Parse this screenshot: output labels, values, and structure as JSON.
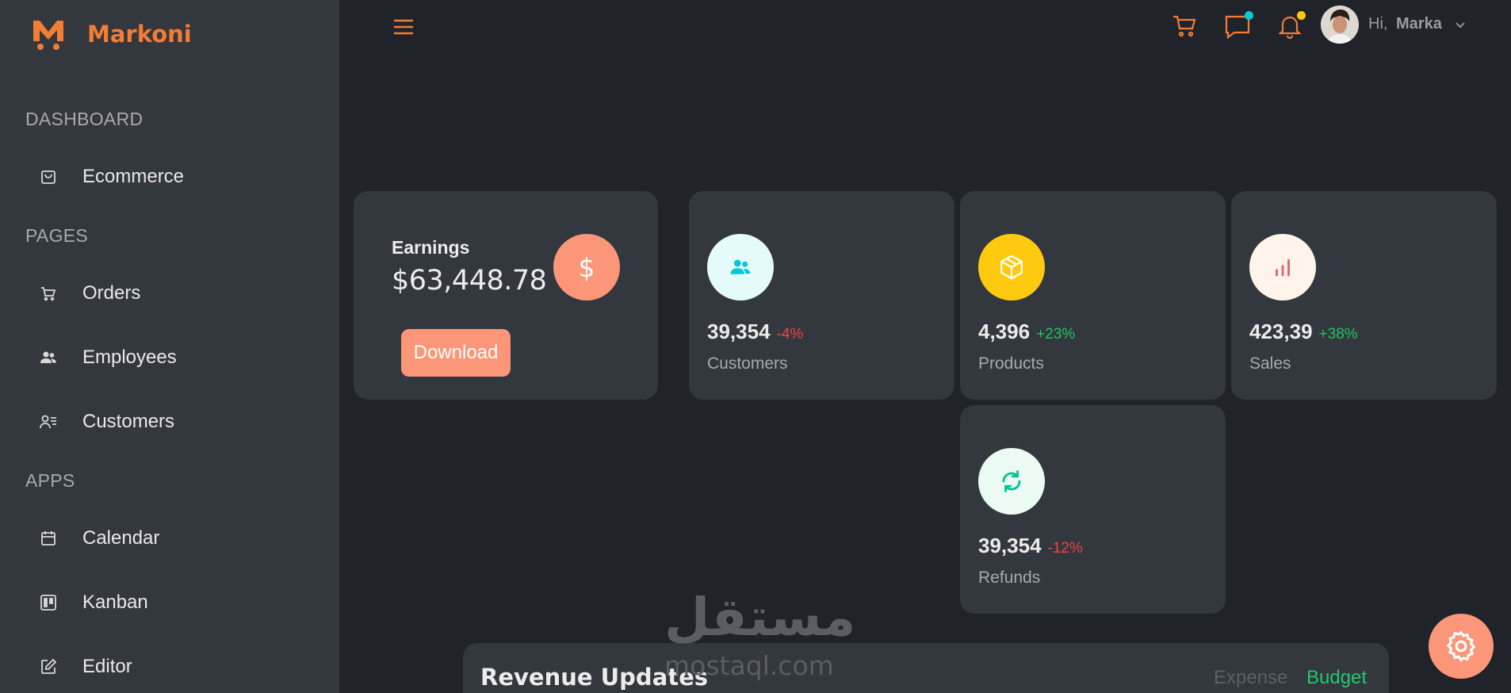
{
  "brand": {
    "name": "Markoni",
    "accent": "#f27d35"
  },
  "sidebar": {
    "sections": [
      {
        "title": "DASHBOARD",
        "items": [
          {
            "label": "Ecommerce",
            "icon": "shopping-bag-icon"
          }
        ]
      },
      {
        "title": "PAGES",
        "items": [
          {
            "label": "Orders",
            "icon": "cart-icon"
          },
          {
            "label": "Employees",
            "icon": "users-icon"
          },
          {
            "label": "Customers",
            "icon": "user-list-icon"
          }
        ]
      },
      {
        "title": "APPS",
        "items": [
          {
            "label": "Calendar",
            "icon": "calendar-icon"
          },
          {
            "label": "Kanban",
            "icon": "kanban-icon"
          },
          {
            "label": "Editor",
            "icon": "edit-icon"
          }
        ]
      }
    ]
  },
  "topbar": {
    "greeting": "Hi,",
    "user_name": "Marka",
    "icons": [
      "menu-icon",
      "cart-icon",
      "chat-icon",
      "bell-icon",
      "chevron-down-icon"
    ],
    "chat_dot_color": "#03c9d7",
    "bell_dot_color": "#fec90f"
  },
  "earnings": {
    "label": "Earnings",
    "value": "$63,448.78",
    "icon_symbol": "$",
    "download_label": "Download",
    "color": "#fb9678"
  },
  "stats": [
    {
      "value": "39,354",
      "change": "-4%",
      "label": "Customers",
      "icon": "users-icon",
      "icon_color": "#03c9d7",
      "icon_bg": "#e5fafb",
      "change_color": "#ef4444"
    },
    {
      "value": "4,396",
      "change": "+23%",
      "label": "Products",
      "icon": "box-icon",
      "icon_color": "#ffffff",
      "icon_bg": "#fec90f",
      "change_color": "#22c55e"
    },
    {
      "value": "423,39",
      "change": "+38%",
      "label": "Sales",
      "icon": "bar-chart-icon",
      "icon_color": "#e46a76",
      "icon_bg": "#fff4ea",
      "change_color": "#22c55e"
    },
    {
      "value": "39,354",
      "change": "-12%",
      "label": "Refunds",
      "icon": "refresh-icon",
      "icon_color": "#00c292",
      "icon_bg": "#ebfaf2",
      "change_color": "#ef4444"
    }
  ],
  "revenue": {
    "title": "Revenue Updates",
    "legend_expense": "Expense",
    "legend_budget": "Budget"
  },
  "watermark": {
    "arabic": "مستقل",
    "latin": "mostaql.com"
  },
  "settings_icon": "gear-icon"
}
